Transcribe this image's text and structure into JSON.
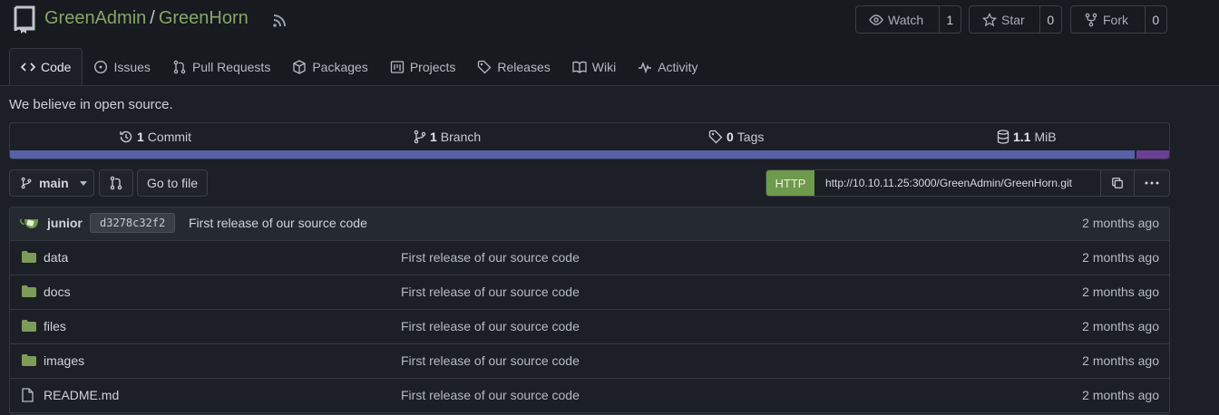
{
  "repo": {
    "owner": "GreenAdmin",
    "separator": "/",
    "name": "GreenHorn",
    "description": "We believe in open source."
  },
  "actions": {
    "watch": {
      "label": "Watch",
      "count": "1"
    },
    "star": {
      "label": "Star",
      "count": "0"
    },
    "fork": {
      "label": "Fork",
      "count": "0"
    }
  },
  "tabs": [
    {
      "label": "Code",
      "icon": "code-icon",
      "active": true
    },
    {
      "label": "Issues",
      "icon": "issue-icon"
    },
    {
      "label": "Pull Requests",
      "icon": "pull-request-icon"
    },
    {
      "label": "Packages",
      "icon": "package-icon"
    },
    {
      "label": "Projects",
      "icon": "project-icon"
    },
    {
      "label": "Releases",
      "icon": "tag-icon"
    },
    {
      "label": "Wiki",
      "icon": "book-icon"
    },
    {
      "label": "Activity",
      "icon": "pulse-icon"
    }
  ],
  "stats": {
    "commits": {
      "count": "1",
      "label": "Commit"
    },
    "branches": {
      "count": "1",
      "label": "Branch"
    },
    "tags": {
      "count": "0",
      "label": "Tags"
    },
    "size": {
      "value": "1.1",
      "unit": "MiB"
    }
  },
  "toolbar": {
    "branch": "main",
    "go_to_file": "Go to file",
    "clone_protocol": "HTTP",
    "clone_url": "http://10.10.11.25:3000/GreenAdmin/GreenHorn.git"
  },
  "latest_commit": {
    "author": "junior",
    "sha": "d3278c32f2",
    "message": "First release of our source code",
    "time": "2 months ago"
  },
  "files": [
    {
      "name": "data",
      "type": "folder",
      "message": "First release of our source code",
      "time": "2 months ago"
    },
    {
      "name": "docs",
      "type": "folder",
      "message": "First release of our source code",
      "time": "2 months ago"
    },
    {
      "name": "files",
      "type": "folder",
      "message": "First release of our source code",
      "time": "2 months ago"
    },
    {
      "name": "images",
      "type": "folder",
      "message": "First release of our source code",
      "time": "2 months ago"
    },
    {
      "name": "README.md",
      "type": "file",
      "message": "First release of our source code",
      "time": "2 months ago"
    }
  ],
  "colors": {
    "accent_green": "#86a66a",
    "http_green": "#6e9a4b",
    "folder": "#7d9c5a",
    "lang_primary": "#5961a6",
    "lang_secondary": "#6a3f94"
  }
}
